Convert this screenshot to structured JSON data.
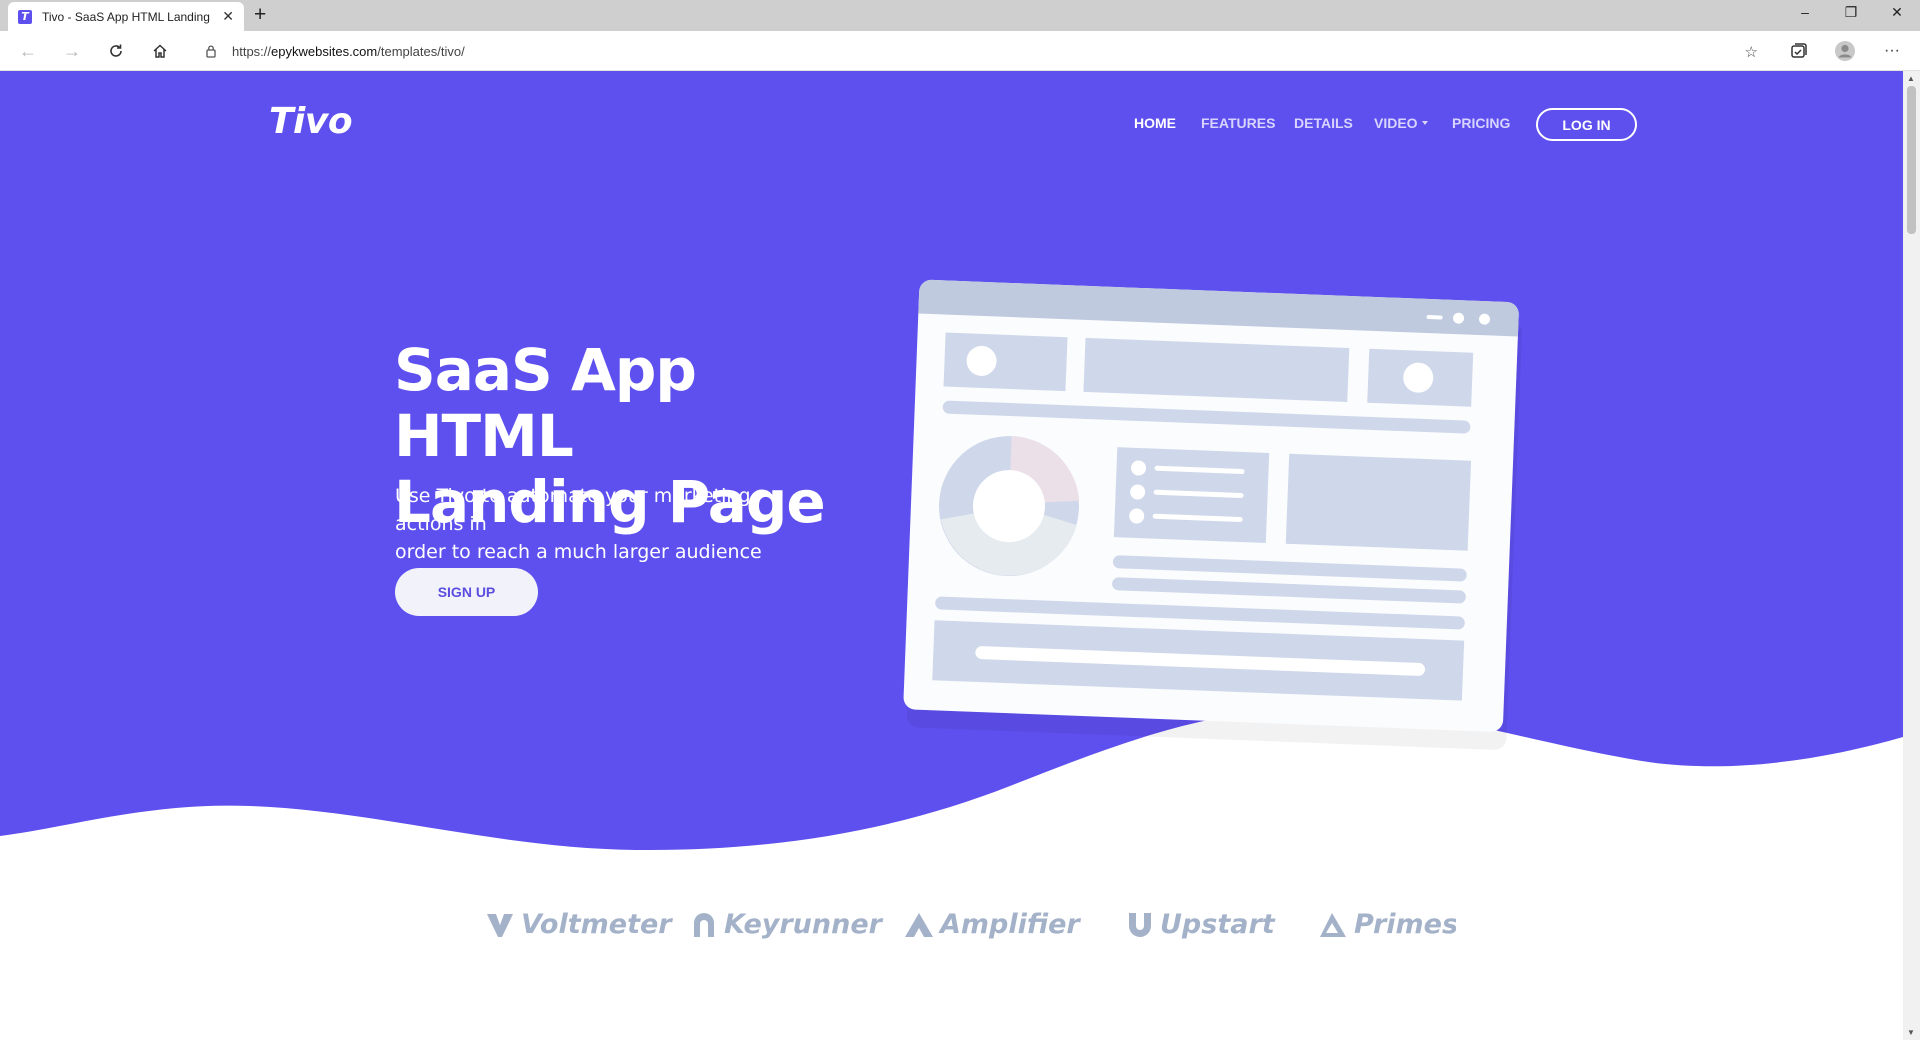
{
  "browser": {
    "tab_title": "Tivo - SaaS App HTML Landing P",
    "tab_favicon_letter": "T",
    "url_scheme": "https://",
    "url_host": "epykwebsites.com",
    "url_path": "/templates/tivo/"
  },
  "nav": {
    "brand": "Tivo",
    "items": [
      {
        "label": "HOME",
        "active": true
      },
      {
        "label": "FEATURES",
        "active": false
      },
      {
        "label": "DETAILS",
        "active": false
      },
      {
        "label": "VIDEO",
        "active": false,
        "dropdown": true
      },
      {
        "label": "PRICING",
        "active": false
      }
    ],
    "login": "LOG IN"
  },
  "hero": {
    "title_line1": "SaaS App HTML",
    "title_line2": "Landing Page",
    "subtitle_line1": "Use Tivo to automate your marketing actions in",
    "subtitle_line2": "order to reach a much larger audience",
    "cta": "SIGN UP"
  },
  "logos": [
    {
      "name": "Voltmeter",
      "icon": "voltmeter-logo-icon"
    },
    {
      "name": "Keyrunner",
      "icon": "keyrunner-logo-icon"
    },
    {
      "name": "Amplifier",
      "icon": "amplifier-logo-icon"
    },
    {
      "name": "Upstart",
      "icon": "upstart-logo-icon"
    },
    {
      "name": "Primeste",
      "icon": "primestep-logo-icon"
    }
  ],
  "colors": {
    "brand_purple": "#5e50ee",
    "logo_gray": "#a4b2c9",
    "illustration_fill": "#cfd8ea"
  }
}
